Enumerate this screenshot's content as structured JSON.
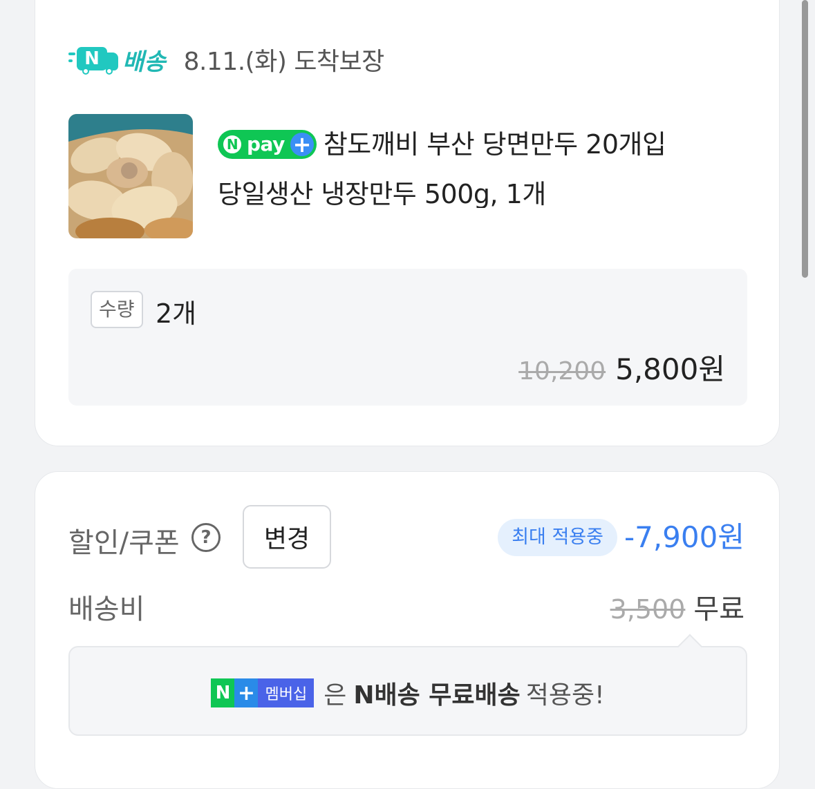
{
  "delivery": {
    "brand": "N",
    "service": "배송",
    "arrival": "8.11.(화) 도착보장"
  },
  "product": {
    "image_alt": "dumpling-photo",
    "npay_n": "N",
    "npay_label": "pay",
    "npay_plus": "+",
    "name_line1": "참도깨비 부산 당면만두 20개입",
    "name_line2": "당일생산 냉장만두 500g, 1개",
    "quantity_tag": "수량",
    "quantity": "2개",
    "original_price": "10,200",
    "sale_price": "5,800원"
  },
  "summary": {
    "coupon_label": "할인/쿠폰",
    "help_icon": "?",
    "change_button": "변경",
    "max_badge": "최대 적용중",
    "discount": "-7,900원",
    "shipping_label": "배송비",
    "shipping_original": "3,500",
    "shipping_free": "무료"
  },
  "notice": {
    "badge_n": "N",
    "badge_plus": "+",
    "badge_text": "멤버십",
    "particle": "은",
    "bold_text": "N배송 무료배송",
    "suffix": "적용중!"
  },
  "colors": {
    "accent_blue": "#3a7ff0",
    "npay_green": "#0fc654",
    "nship_teal": "#21c8c0"
  }
}
